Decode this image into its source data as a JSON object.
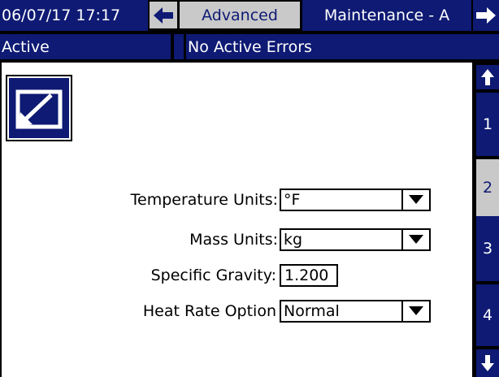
{
  "status_bar": {
    "datetime": "06/07/17 17:17",
    "left_arrow_icon": "arrow-left-icon",
    "current_screen": "Advanced",
    "next_screen": "Maintenance - A",
    "right_arrow_icon": "arrow-right-icon"
  },
  "status_row": {
    "state": "Active",
    "errors": "No Active Errors"
  },
  "screen": {
    "edit_icon": "edit-setup-icon",
    "fields": {
      "temperature_units": {
        "label": "Temperature Units:",
        "value": "°F"
      },
      "mass_units": {
        "label": "Mass Units:",
        "value": "kg"
      },
      "specific_gravity": {
        "label": "Specific Gravity:",
        "value": "1.200"
      },
      "heat_rate_option": {
        "label": "Heat Rate Option",
        "value": "Normal"
      }
    }
  },
  "side_nav": {
    "up_icon": "arrow-up-icon",
    "down_icon": "arrow-down-icon",
    "pages": [
      "1",
      "2",
      "3",
      "4"
    ],
    "selected_page": "2"
  },
  "colors": {
    "navy": "#0e1a73",
    "selected_gray": "#c9c9c9",
    "white": "#ffffff",
    "black": "#000000"
  }
}
